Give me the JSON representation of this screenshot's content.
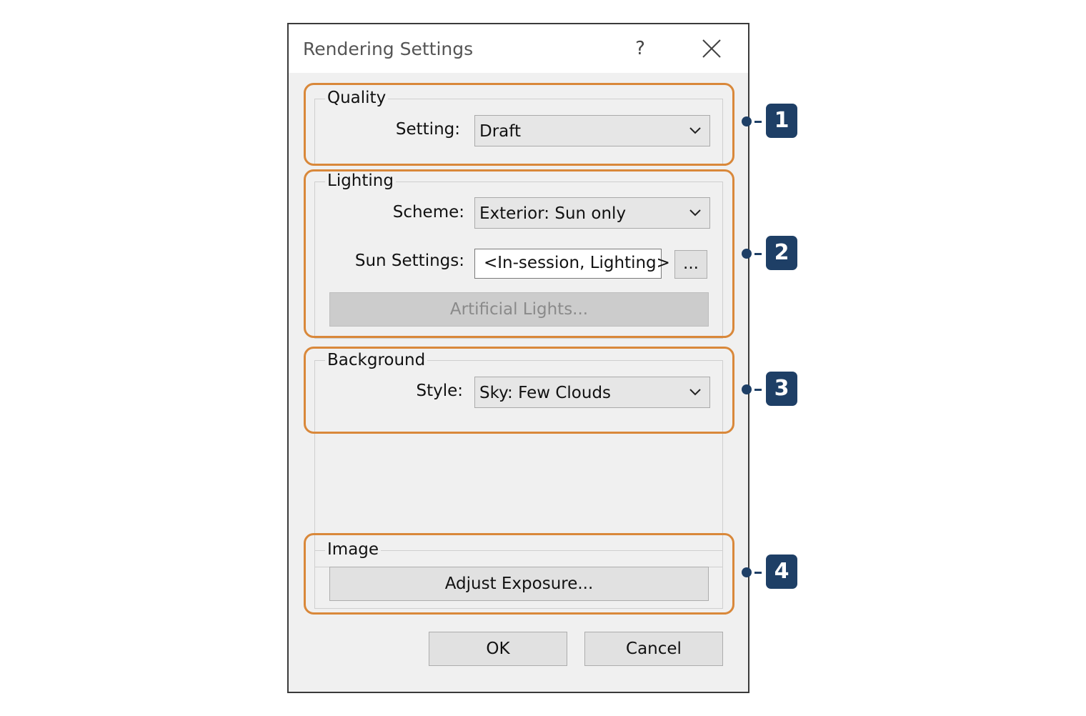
{
  "dialog": {
    "title": "Rendering Settings",
    "help_label": "?",
    "close_label": "close"
  },
  "quality": {
    "group_label": "Quality",
    "setting_label": "Setting:",
    "setting_value": "Draft"
  },
  "lighting": {
    "group_label": "Lighting",
    "scheme_label": "Scheme:",
    "scheme_value": "Exterior: Sun only",
    "sun_label": "Sun Settings:",
    "sun_value": "<In-session, Lighting>",
    "browse_label": "...",
    "artificial_label": "Artificial Lights..."
  },
  "background": {
    "group_label": "Background",
    "style_label": "Style:",
    "style_value": "Sky: Few Clouds"
  },
  "image": {
    "group_label": "Image",
    "exposure_label": "Adjust Exposure..."
  },
  "footer": {
    "ok_label": "OK",
    "cancel_label": "Cancel"
  },
  "callouts": [
    "1",
    "2",
    "3",
    "4"
  ],
  "colors": {
    "highlight": "#d9883a",
    "badge": "#1e3f66"
  }
}
